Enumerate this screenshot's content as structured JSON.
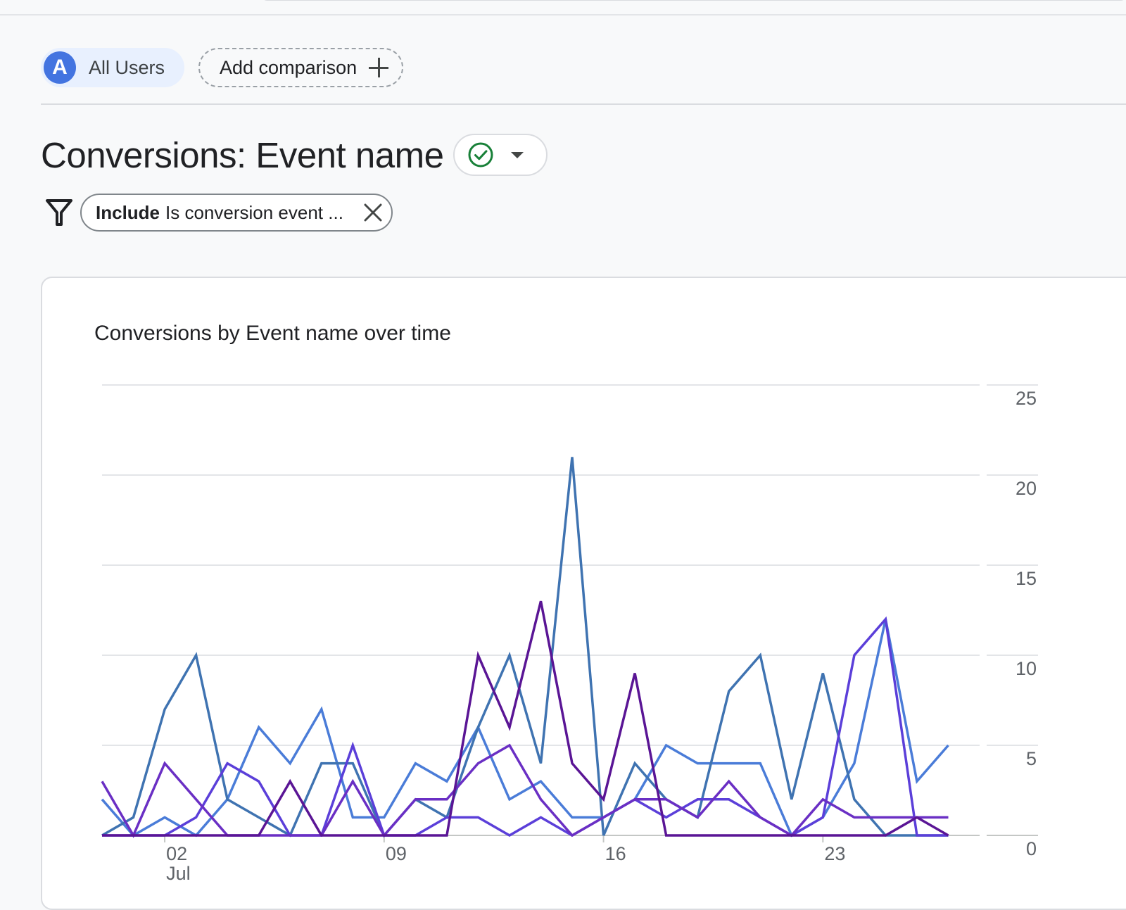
{
  "comparisons": {
    "user_segment": {
      "avatar_letter": "A",
      "label": "All Users"
    },
    "add_comparison_label": "Add comparison"
  },
  "header": {
    "title": "Conversions: Event name",
    "status_icon": "check-circle-icon",
    "status_color": "#188038"
  },
  "filter": {
    "include_label": "Include",
    "condition_text": "Is conversion event ..."
  },
  "card": {
    "title": "Conversions by Event name over time"
  },
  "chart_data": {
    "type": "line",
    "title": "Conversions by Event name over time",
    "x_start_label": "Jun 30",
    "x": [
      "Jun 30",
      "Jul 01",
      "Jul 02",
      "Jul 03",
      "Jul 04",
      "Jul 05",
      "Jul 06",
      "Jul 07",
      "Jul 08",
      "Jul 09",
      "Jul 10",
      "Jul 11",
      "Jul 12",
      "Jul 13",
      "Jul 14",
      "Jul 15",
      "Jul 16",
      "Jul 17",
      "Jul 18",
      "Jul 19",
      "Jul 20",
      "Jul 21",
      "Jul 22",
      "Jul 23",
      "Jul 24",
      "Jul 25",
      "Jul 26",
      "Jul 27",
      "Jul 28"
    ],
    "x_tick_labels": [
      {
        "label": "02",
        "sublabel": "Jul",
        "index": 2
      },
      {
        "label": "09",
        "sublabel": "",
        "index": 9
      },
      {
        "label": "16",
        "sublabel": "",
        "index": 16
      },
      {
        "label": "23",
        "sublabel": "",
        "index": 23
      }
    ],
    "y_ticks": [
      0,
      5,
      10,
      15,
      20,
      25
    ],
    "ylim": [
      0,
      25
    ],
    "y_axis_side": "right",
    "grid": true,
    "series": [
      {
        "color": "#4a7cd8",
        "values": [
          2,
          0,
          1,
          0,
          2,
          6,
          4,
          7,
          1,
          1,
          4,
          3,
          6,
          2,
          3,
          1,
          1,
          2,
          5,
          4,
          4,
          4,
          0,
          1,
          4,
          12,
          3,
          5
        ]
      },
      {
        "color": "#3f73b1",
        "values": [
          0,
          1,
          7,
          10,
          2,
          1,
          0,
          4,
          4,
          0,
          2,
          1,
          6,
          10,
          4,
          21,
          0,
          4,
          2,
          1,
          8,
          10,
          2,
          9,
          2,
          0,
          0,
          0
        ]
      },
      {
        "color": "#5b3fd9",
        "values": [
          0,
          0,
          0,
          1,
          4,
          3,
          0,
          0,
          5,
          0,
          0,
          1,
          1,
          0,
          1,
          0,
          1,
          2,
          1,
          2,
          2,
          1,
          0,
          1,
          10,
          12,
          0,
          0
        ]
      },
      {
        "color": "#6a2fc4",
        "values": [
          3,
          0,
          4,
          2,
          0,
          0,
          0,
          0,
          3,
          0,
          2,
          2,
          4,
          5,
          2,
          0,
          1,
          2,
          2,
          1,
          3,
          1,
          0,
          2,
          1,
          1,
          1,
          1
        ]
      },
      {
        "color": "#5a1595",
        "values": [
          0,
          0,
          0,
          0,
          0,
          0,
          3,
          0,
          0,
          0,
          0,
          0,
          10,
          6,
          13,
          4,
          2,
          9,
          0,
          0,
          0,
          0,
          0,
          0,
          0,
          0,
          1,
          0
        ]
      }
    ]
  }
}
